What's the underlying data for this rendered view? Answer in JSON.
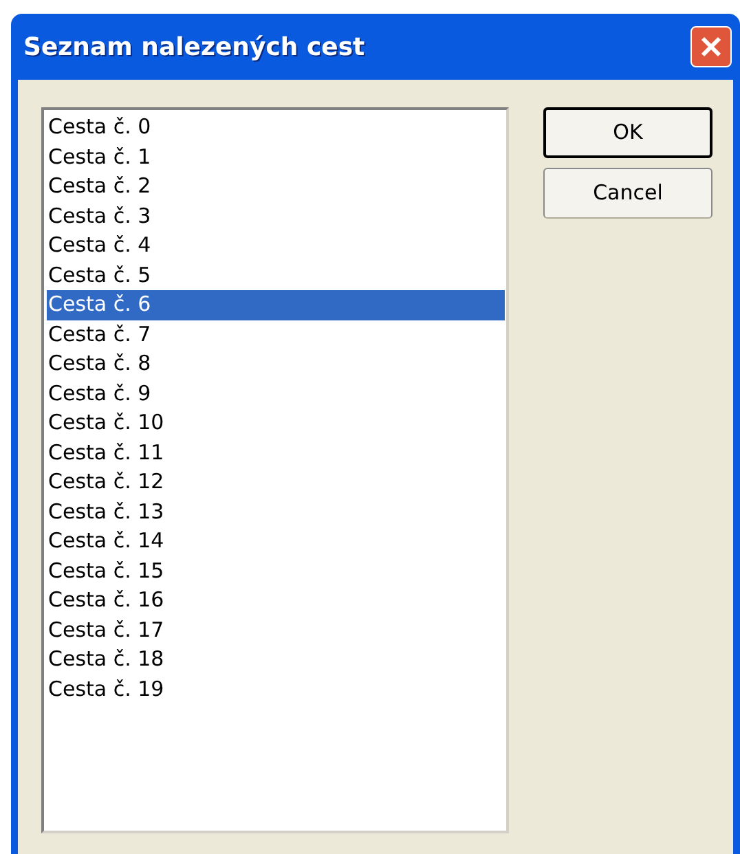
{
  "window": {
    "title": "Seznam nalezených cest"
  },
  "list": {
    "items": [
      {
        "label": "Cesta č. 0",
        "selected": false
      },
      {
        "label": "Cesta č. 1",
        "selected": false
      },
      {
        "label": "Cesta č. 2",
        "selected": false
      },
      {
        "label": "Cesta č. 3",
        "selected": false
      },
      {
        "label": "Cesta č. 4",
        "selected": false
      },
      {
        "label": "Cesta č. 5",
        "selected": false
      },
      {
        "label": "Cesta č. 6",
        "selected": true
      },
      {
        "label": "Cesta č. 7",
        "selected": false
      },
      {
        "label": "Cesta č. 8",
        "selected": false
      },
      {
        "label": "Cesta č. 9",
        "selected": false
      },
      {
        "label": "Cesta č. 10",
        "selected": false
      },
      {
        "label": "Cesta č. 11",
        "selected": false
      },
      {
        "label": "Cesta č. 12",
        "selected": false
      },
      {
        "label": "Cesta č. 13",
        "selected": false
      },
      {
        "label": "Cesta č. 14",
        "selected": false
      },
      {
        "label": "Cesta č. 15",
        "selected": false
      },
      {
        "label": "Cesta č. 16",
        "selected": false
      },
      {
        "label": "Cesta č. 17",
        "selected": false
      },
      {
        "label": "Cesta č. 18",
        "selected": false
      },
      {
        "label": "Cesta č. 19",
        "selected": false
      }
    ]
  },
  "buttons": [
    {
      "label": "OK",
      "default": true
    },
    {
      "label": "Cancel",
      "default": false
    }
  ]
}
